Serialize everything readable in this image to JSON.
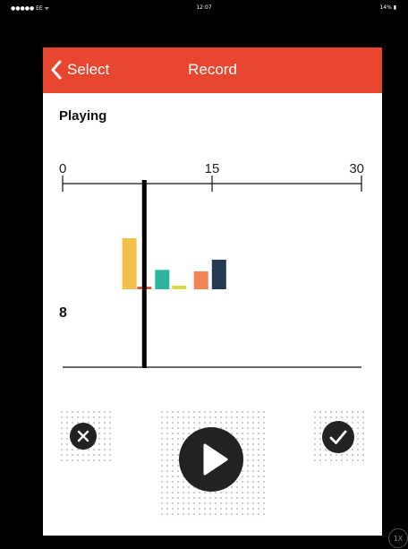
{
  "status_bar": {
    "carrier": "●●●●● EE ᯤ",
    "time": "12:07",
    "battery": "14% ▮"
  },
  "header": {
    "back_label": "Select",
    "title": "Record",
    "color": "#e8462e",
    "back_icon": "chevron-left-icon"
  },
  "status_label": "Playing",
  "counter": "8",
  "chart_data": {
    "type": "bar",
    "x_ticks": [
      "0",
      "15",
      "30"
    ],
    "xlim": [
      0,
      30
    ],
    "playhead": 8.2,
    "bars": [
      {
        "x": 6.7,
        "value": 1.0,
        "color": "#f5c04a"
      },
      {
        "x": 8.2,
        "value": 0.05,
        "color": "#d9503e"
      },
      {
        "x": 10.0,
        "value": 0.38,
        "color": "#2bb5a0"
      },
      {
        "x": 11.7,
        "value": 0.07,
        "color": "#d8dc3c"
      },
      {
        "x": 13.9,
        "value": 0.35,
        "color": "#f28456"
      },
      {
        "x": 15.7,
        "value": 0.58,
        "color": "#263a52"
      }
    ]
  },
  "controls": {
    "cancel_icon": "close-icon",
    "play_icon": "play-icon",
    "confirm_icon": "checkmark-icon"
  },
  "badge": "1X"
}
